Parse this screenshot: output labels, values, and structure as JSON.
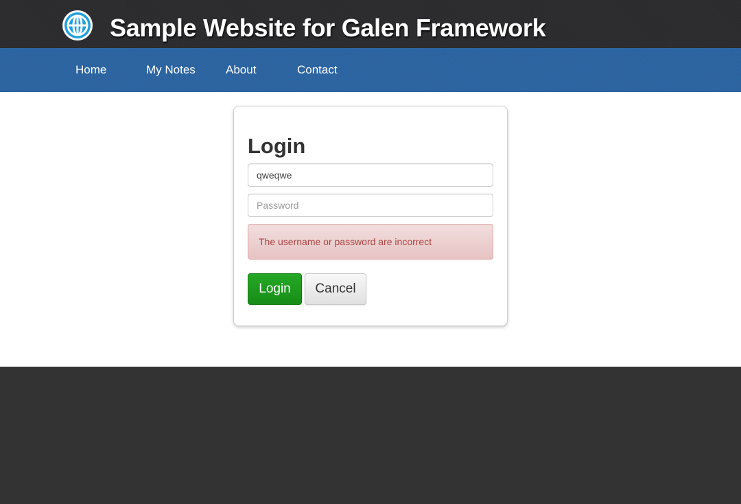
{
  "header": {
    "title": "Sample Website for Galen Framework",
    "logo_icon": "globe-icon"
  },
  "nav": {
    "items": [
      {
        "label": "Home"
      },
      {
        "label": "My Notes"
      },
      {
        "label": "About"
      },
      {
        "label": "Contact"
      }
    ]
  },
  "login": {
    "title": "Login",
    "username_value": "qweqwe",
    "password_placeholder": "Password",
    "error_message": "The username or password are incorrect",
    "login_label": "Login",
    "cancel_label": "Cancel"
  },
  "colors": {
    "header_bg": "#2b2b2d",
    "nav_bg": "#2a63a0",
    "login_button": "#1e9e1e",
    "alert_bg": "#f2dede",
    "alert_text": "#a94442",
    "footer_bg": "#333333"
  }
}
